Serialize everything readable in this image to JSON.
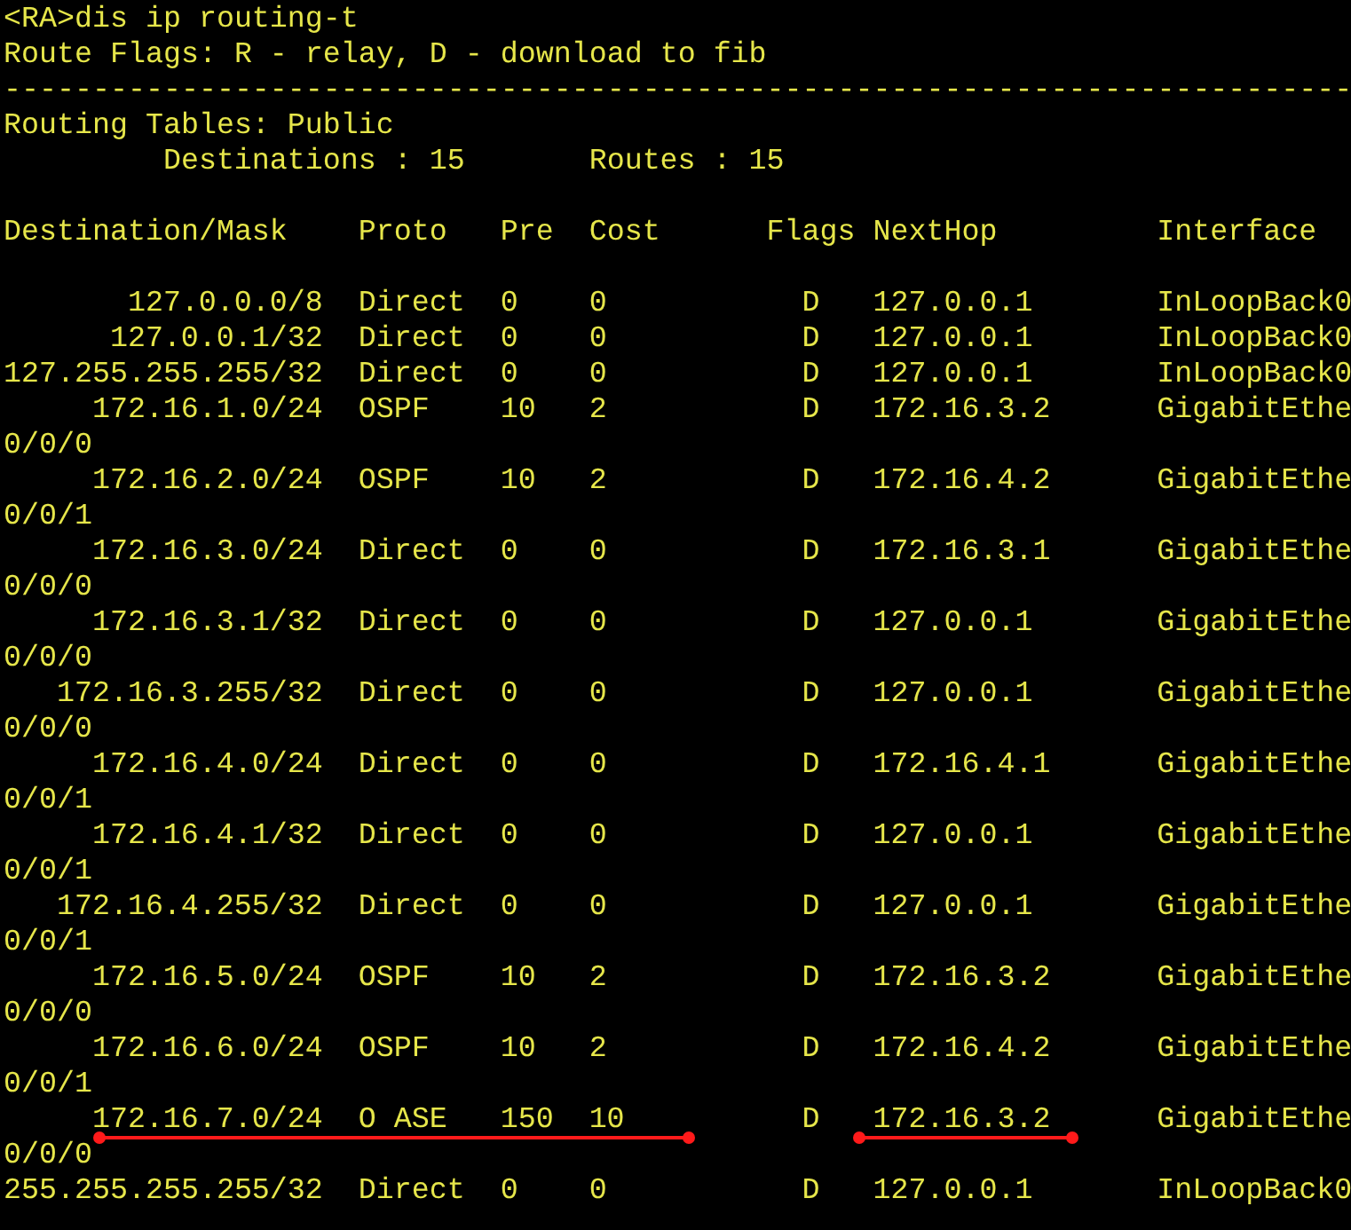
{
  "command_line": "<RA>dis ip routing-t",
  "flags_legend": "Route Flags: R - relay, D - download to fib",
  "separator": "----------------------------------------------------------------------------",
  "table_title": "Routing Tables: Public",
  "summary": {
    "destinations_label": "Destinations :",
    "destinations": "15",
    "routes_label": "Routes :",
    "routes": "15"
  },
  "columns": [
    "Destination/Mask",
    "Proto",
    "Pre",
    "Cost",
    "Flags",
    "NextHop",
    "Interface"
  ],
  "rows": [
    {
      "destination": "127.0.0.0/8",
      "proto": "Direct",
      "pre": "0",
      "cost": "0",
      "flags": "D",
      "nexthop": "127.0.0.1",
      "interface": "InLoopBack0",
      "marked": false
    },
    {
      "destination": "127.0.0.1/32",
      "proto": "Direct",
      "pre": "0",
      "cost": "0",
      "flags": "D",
      "nexthop": "127.0.0.1",
      "interface": "InLoopBack0",
      "marked": false
    },
    {
      "destination": "127.255.255.255/32",
      "proto": "Direct",
      "pre": "0",
      "cost": "0",
      "flags": "D",
      "nexthop": "127.0.0.1",
      "interface": "InLoopBack0",
      "marked": false
    },
    {
      "destination": "172.16.1.0/24",
      "proto": "OSPF",
      "pre": "10",
      "cost": "2",
      "flags": "D",
      "nexthop": "172.16.3.2",
      "interface": "GigabitEthe",
      "wrap": "0/0/0",
      "marked": false
    },
    {
      "destination": "172.16.2.0/24",
      "proto": "OSPF",
      "pre": "10",
      "cost": "2",
      "flags": "D",
      "nexthop": "172.16.4.2",
      "interface": "GigabitEthe",
      "wrap": "0/0/1",
      "marked": false
    },
    {
      "destination": "172.16.3.0/24",
      "proto": "Direct",
      "pre": "0",
      "cost": "0",
      "flags": "D",
      "nexthop": "172.16.3.1",
      "interface": "GigabitEthe",
      "wrap": "0/0/0",
      "marked": false
    },
    {
      "destination": "172.16.3.1/32",
      "proto": "Direct",
      "pre": "0",
      "cost": "0",
      "flags": "D",
      "nexthop": "127.0.0.1",
      "interface": "GigabitEthe",
      "wrap": "0/0/0",
      "marked": false
    },
    {
      "destination": "172.16.3.255/32",
      "proto": "Direct",
      "pre": "0",
      "cost": "0",
      "flags": "D",
      "nexthop": "127.0.0.1",
      "interface": "GigabitEthe",
      "wrap": "0/0/0",
      "marked": false
    },
    {
      "destination": "172.16.4.0/24",
      "proto": "Direct",
      "pre": "0",
      "cost": "0",
      "flags": "D",
      "nexthop": "172.16.4.1",
      "interface": "GigabitEthe",
      "wrap": "0/0/1",
      "marked": false
    },
    {
      "destination": "172.16.4.1/32",
      "proto": "Direct",
      "pre": "0",
      "cost": "0",
      "flags": "D",
      "nexthop": "127.0.0.1",
      "interface": "GigabitEthe",
      "wrap": "0/0/1",
      "marked": false
    },
    {
      "destination": "172.16.4.255/32",
      "proto": "Direct",
      "pre": "0",
      "cost": "0",
      "flags": "D",
      "nexthop": "127.0.0.1",
      "interface": "GigabitEthe",
      "wrap": "0/0/1",
      "marked": false
    },
    {
      "destination": "172.16.5.0/24",
      "proto": "OSPF",
      "pre": "10",
      "cost": "2",
      "flags": "D",
      "nexthop": "172.16.3.2",
      "interface": "GigabitEthe",
      "wrap": "0/0/0",
      "marked": false
    },
    {
      "destination": "172.16.6.0/24",
      "proto": "OSPF",
      "pre": "10",
      "cost": "2",
      "flags": "D",
      "nexthop": "172.16.4.2",
      "interface": "GigabitEthe",
      "wrap": "0/0/1",
      "marked": false
    },
    {
      "destination": "172.16.7.0/24",
      "proto": "O ASE",
      "pre": "150",
      "cost": "10",
      "flags": "D",
      "nexthop": "172.16.3.2",
      "interface": "GigabitEthe",
      "wrap": "0/0/0",
      "marked": true
    },
    {
      "destination": "255.255.255.255/32",
      "proto": "Direct",
      "pre": "0",
      "cost": "0",
      "flags": "D",
      "nexthop": "127.0.0.1",
      "interface": "InLoopBack0",
      "marked": false
    }
  ]
}
